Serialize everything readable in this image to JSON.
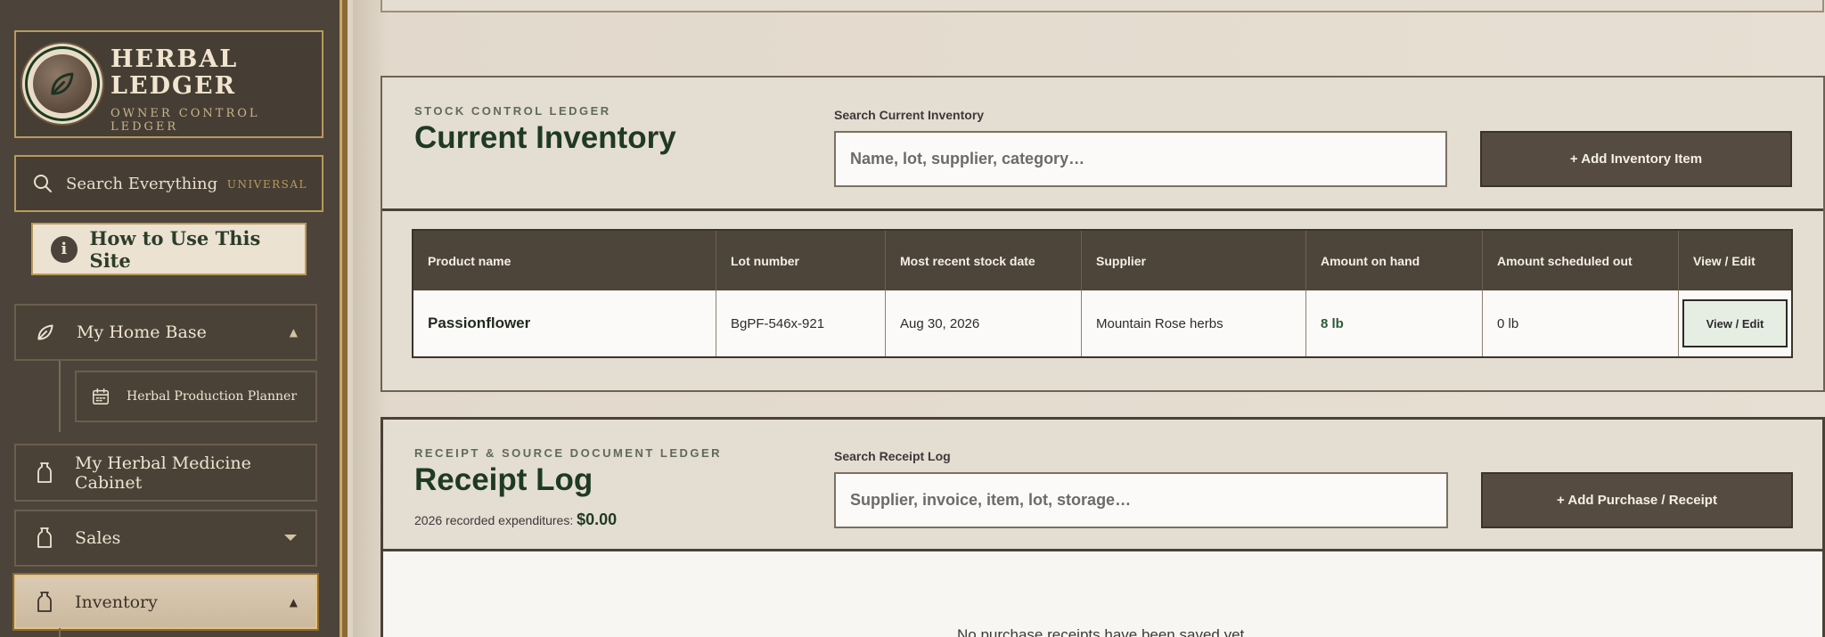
{
  "brand": {
    "title_line1": "HERBAL",
    "title_line2": "LEDGER",
    "subtitle": "OWNER CONTROL LEDGER"
  },
  "search_everything": {
    "label": "Search Everything",
    "badge": "UNIVERSAL"
  },
  "how_to": {
    "icon_glyph": "i",
    "label": "How to Use This Site"
  },
  "nav": {
    "home_base": "My Home Base",
    "production_planner": "Herbal Production Planner",
    "medicine_cabinet_line1": "My Herbal Medicine",
    "medicine_cabinet_line2": "Cabinet",
    "sales": "Sales",
    "inventory": "Inventory"
  },
  "inventory_panel": {
    "eyebrow": "STOCK CONTROL LEDGER",
    "title": "Current Inventory",
    "search_label": "Search Current Inventory",
    "search_placeholder": "Name, lot, supplier, category…",
    "add_button": "+ Add Inventory Item",
    "columns": [
      "Product name",
      "Lot number",
      "Most recent stock date",
      "Supplier",
      "Amount on hand",
      "Amount scheduled out",
      "View / Edit"
    ],
    "rows": [
      {
        "product": "Passionflower",
        "lot": "BgPF-546x-921",
        "stock_date": "Aug 30, 2026",
        "supplier": "Mountain Rose herbs",
        "on_hand": "8 lb",
        "scheduled_out": "0 lb",
        "action": "View / Edit"
      }
    ]
  },
  "receipt_panel": {
    "eyebrow": "RECEIPT & SOURCE DOCUMENT LEDGER",
    "title": "Receipt Log",
    "expenditures_label": "2026 recorded expenditures:",
    "expenditures_value": "$0.00",
    "search_label": "Search Receipt Log",
    "search_placeholder": "Supplier, invoice, item, lot, storage…",
    "add_button": "+ Add Purchase / Receipt",
    "empty_message": "No purchase receipts have been saved yet."
  },
  "colors": {
    "sidebar_bg": "#4c443a",
    "accent_gold": "#b99a5c",
    "title_green": "#1f3a24",
    "button_dark": "#554b40"
  }
}
